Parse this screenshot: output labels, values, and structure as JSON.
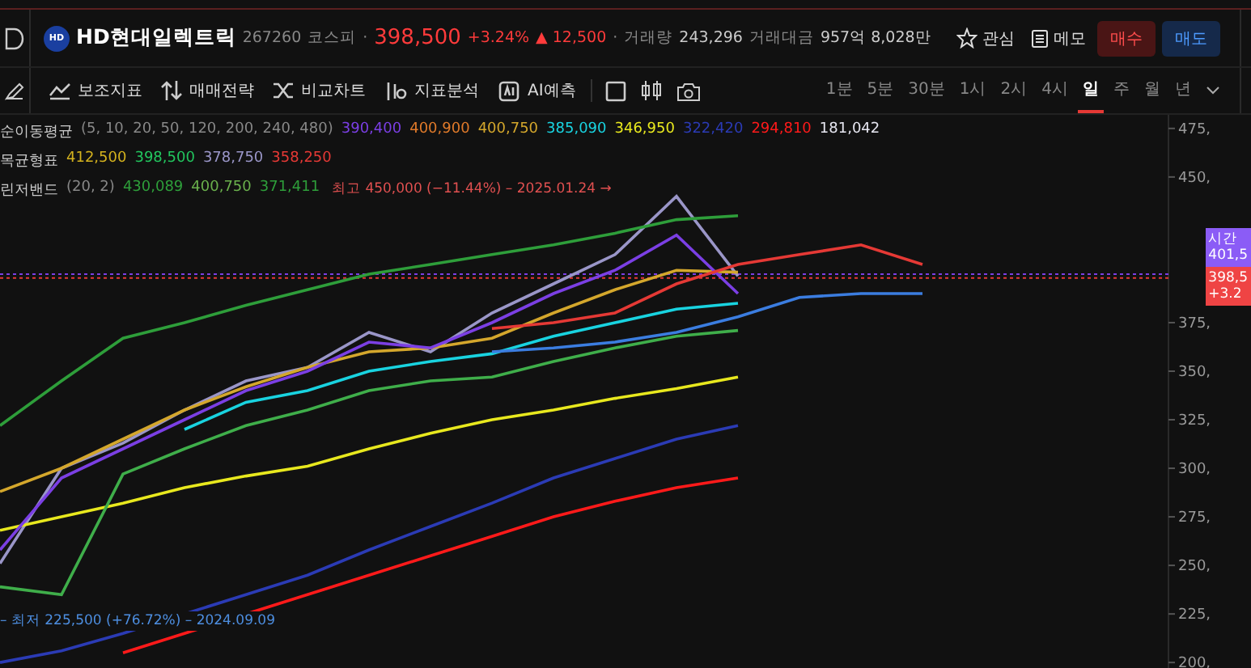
{
  "header": {
    "logo": "HD",
    "name": "HD현대일렉트릭",
    "code": "267260",
    "market": "코스피",
    "separator": "·",
    "price": "398,500",
    "change_pct": "+3.24%",
    "change_arrow": "▲",
    "change": "12,500",
    "separator_2": "·",
    "volume_label": "거래량",
    "volume": "243,296",
    "amount_label": "거래대금",
    "amount": "957억 8,028만",
    "watch": "관심",
    "memo": "메모",
    "buy": "매수",
    "sell": "매도"
  },
  "toolbar": {
    "tools": [
      {
        "label": "보조지표",
        "kind": "indicator"
      },
      {
        "label": "매매전략",
        "kind": "strategy"
      },
      {
        "label": "비교차트",
        "kind": "compare"
      },
      {
        "label": "지표분석",
        "kind": "analysis"
      },
      {
        "label": "AI예측",
        "kind": "ai"
      }
    ],
    "periods": [
      {
        "label": "1분",
        "selected": false
      },
      {
        "label": "5분",
        "selected": false
      },
      {
        "label": "30분",
        "selected": false
      },
      {
        "label": "1시",
        "selected": false
      },
      {
        "label": "2시",
        "selected": false
      },
      {
        "label": "4시",
        "selected": false
      },
      {
        "label": "일",
        "selected": true
      },
      {
        "label": "주",
        "selected": false
      },
      {
        "label": "월",
        "selected": false
      },
      {
        "label": "년",
        "selected": false
      }
    ]
  },
  "legend": [
    {
      "name": "순이동평균",
      "params": "(5, 10, 20, 50, 120, 200, 240, 480)",
      "values": [
        {
          "text": "390,400",
          "color": "#7b3fe4"
        },
        {
          "text": "400,900",
          "color": "#e07a2a"
        },
        {
          "text": "400,750",
          "color": "#d4a72c"
        },
        {
          "text": "385,090",
          "color": "#19d3e0"
        },
        {
          "text": "346,950",
          "color": "#e8e81e"
        },
        {
          "text": "322,420",
          "color": "#2b3bb5"
        },
        {
          "text": "294,810",
          "color": "#ff1a1a"
        },
        {
          "text": "181,042",
          "color": "#e6e6f0"
        }
      ]
    },
    {
      "name": "목균형표",
      "values": [
        {
          "text": "412,500",
          "color": "#d4b21e"
        },
        {
          "text": "398,500",
          "color": "#22c55e"
        },
        {
          "text": "378,750",
          "color": "#9a96c8"
        },
        {
          "text": "358,250",
          "color": "#e53935"
        }
      ]
    },
    {
      "name": "린저밴드",
      "params": "(20, 2)",
      "values": [
        {
          "text": "430,089",
          "color": "#2e9e3a"
        },
        {
          "text": "400,750",
          "color": "#6ab04c"
        },
        {
          "text": "371,411",
          "color": "#2e9e3a"
        }
      ]
    }
  ],
  "price_markers": [
    {
      "kind": "high",
      "text": "최고 450,000 (−11.44%) – 2025.01.24 →"
    },
    {
      "kind": "low",
      "text": "– 최저 225,500 (+76.72%) – 2024.09.09"
    }
  ],
  "chart_data": {
    "type": "line",
    "categories": [
      null,
      null,
      null,
      null,
      null,
      null,
      null,
      null,
      null,
      null,
      null,
      null,
      null,
      null,
      null,
      null,
      null,
      null,
      null
    ],
    "ylim": [
      193,
      482
    ],
    "ref_lines": [
      {
        "value": 400,
        "axis": "y",
        "color": "#7b3fe4"
      },
      {
        "value": 398,
        "axis": "y",
        "color": "#e53935"
      }
    ],
    "yticks": [
      {
        "value": 475,
        "label": "475,"
      },
      {
        "value": 450,
        "label": "450,"
      },
      {
        "value": 375,
        "label": "375,"
      },
      {
        "value": 350,
        "label": "350,"
      },
      {
        "value": 325,
        "label": "325,"
      },
      {
        "value": 300,
        "label": "300,"
      },
      {
        "value": 275,
        "label": "275,"
      },
      {
        "value": 250,
        "label": "250,"
      },
      {
        "value": 225,
        "label": "225,"
      },
      {
        "value": 200,
        "label": "200,"
      }
    ],
    "series": [
      {
        "color": "#9a96c8",
        "values": [
          251,
          300,
          313,
          330,
          345,
          352,
          370,
          360,
          380,
          395,
          410,
          440,
          399,
          null,
          null,
          null,
          null,
          null,
          null
        ]
      },
      {
        "color": "#ff1a1a",
        "values": [
          null,
          null,
          205,
          215,
          225,
          235,
          245,
          255,
          265,
          275,
          283,
          290,
          295,
          null,
          null,
          null,
          null,
          null,
          null
        ]
      },
      {
        "color": "#2b3bb5",
        "values": [
          200,
          206,
          215,
          225,
          235,
          245,
          258,
          270,
          282,
          295,
          305,
          315,
          322,
          null,
          null,
          null,
          null,
          null,
          null
        ]
      },
      {
        "color": "#e8e81e",
        "values": [
          268,
          275,
          282,
          290,
          296,
          301,
          310,
          318,
          325,
          330,
          336,
          341,
          347,
          null,
          null,
          null,
          null,
          null,
          null
        ]
      },
      {
        "color": "#19d3e0",
        "values": [
          null,
          null,
          null,
          320,
          334,
          340,
          350,
          355,
          359,
          368,
          375,
          382,
          385,
          null,
          null,
          null,
          null,
          null,
          null
        ]
      },
      {
        "color": "#d4a72c",
        "values": [
          288,
          300,
          315,
          330,
          342,
          352,
          360,
          362,
          367,
          380,
          392,
          402,
          401,
          null,
          null,
          null,
          null,
          null,
          null
        ]
      },
      {
        "color": "#7b3fe4",
        "values": [
          258,
          295,
          310,
          325,
          340,
          350,
          365,
          362,
          375,
          390,
          402,
          420,
          390,
          null,
          null,
          null,
          null,
          null,
          null
        ]
      },
      {
        "color": "#2e9e3a",
        "values": [
          322,
          345,
          367,
          375,
          384,
          392,
          400,
          405,
          410,
          415,
          421,
          428,
          430,
          null,
          null,
          null,
          null,
          null,
          null
        ]
      },
      {
        "color": "#3fae4a",
        "values": [
          239,
          235,
          297,
          310,
          322,
          330,
          340,
          345,
          347,
          355,
          362,
          368,
          371,
          null,
          null,
          null,
          null,
          null,
          null
        ]
      },
      {
        "color": "#e53935",
        "values": [
          null,
          null,
          null,
          null,
          null,
          null,
          null,
          null,
          372,
          375,
          380,
          395,
          405,
          410,
          415,
          405,
          null,
          null,
          null
        ]
      },
      {
        "color": "#3b7de0",
        "values": [
          null,
          null,
          null,
          null,
          null,
          null,
          null,
          null,
          360,
          362,
          365,
          370,
          378,
          388,
          390,
          390,
          null,
          null,
          null
        ]
      }
    ]
  },
  "price_badges": [
    {
      "kind": "afterhours",
      "lines": [
        "시간",
        "401,5"
      ]
    },
    {
      "kind": "current",
      "lines": [
        "398,5",
        "+3.2"
      ]
    }
  ]
}
